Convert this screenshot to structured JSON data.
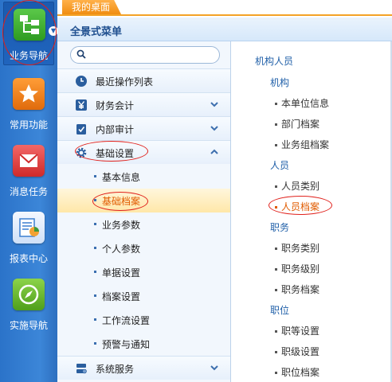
{
  "rail": {
    "items": [
      {
        "label": "业务导航",
        "icon": "org-chart-icon"
      },
      {
        "label": "常用功能",
        "icon": "star-icon"
      },
      {
        "label": "消息任务",
        "icon": "mail-icon"
      },
      {
        "label": "报表中心",
        "icon": "report-icon"
      },
      {
        "label": "实施导航",
        "icon": "compass-icon"
      }
    ]
  },
  "topbar": {
    "tab_label": "我的桌面"
  },
  "panel": {
    "title": "全景式菜单"
  },
  "search": {
    "value": "",
    "placeholder": ""
  },
  "menu": {
    "items": [
      {
        "label": "最近操作列表",
        "icon": "clock-icon"
      },
      {
        "label": "财务会计",
        "icon": "yen-icon"
      },
      {
        "label": "内部审计",
        "icon": "clipboard-check-icon"
      },
      {
        "label": "基础设置",
        "icon": "gear-icon"
      },
      {
        "label": "系统服务",
        "icon": "server-icon"
      }
    ],
    "sub_items": [
      "基本信息",
      "基础档案",
      "业务参数",
      "个人参数",
      "单据设置",
      "档案设置",
      "工作流设置",
      "预警与通知"
    ],
    "selected_sub": "基础档案"
  },
  "content": {
    "title": "机构人员",
    "groups": [
      {
        "label": "机构",
        "items": [
          "本单位信息",
          "部门档案",
          "业务组档案"
        ]
      },
      {
        "label": "人员",
        "items": [
          "人员类别",
          "人员档案"
        ]
      },
      {
        "label": "职务",
        "items": [
          "职务类别",
          "职务级别",
          "职务档案"
        ]
      },
      {
        "label": "职位",
        "items": [
          "职等设置",
          "职级设置",
          "职位档案"
        ]
      }
    ]
  },
  "colors": {
    "accent_orange": "#f08d12",
    "rail_blue": "#3c86d8",
    "link_blue": "#1f5fa8",
    "highlight": "#e05b00",
    "annotation_red": "#e0201b"
  }
}
